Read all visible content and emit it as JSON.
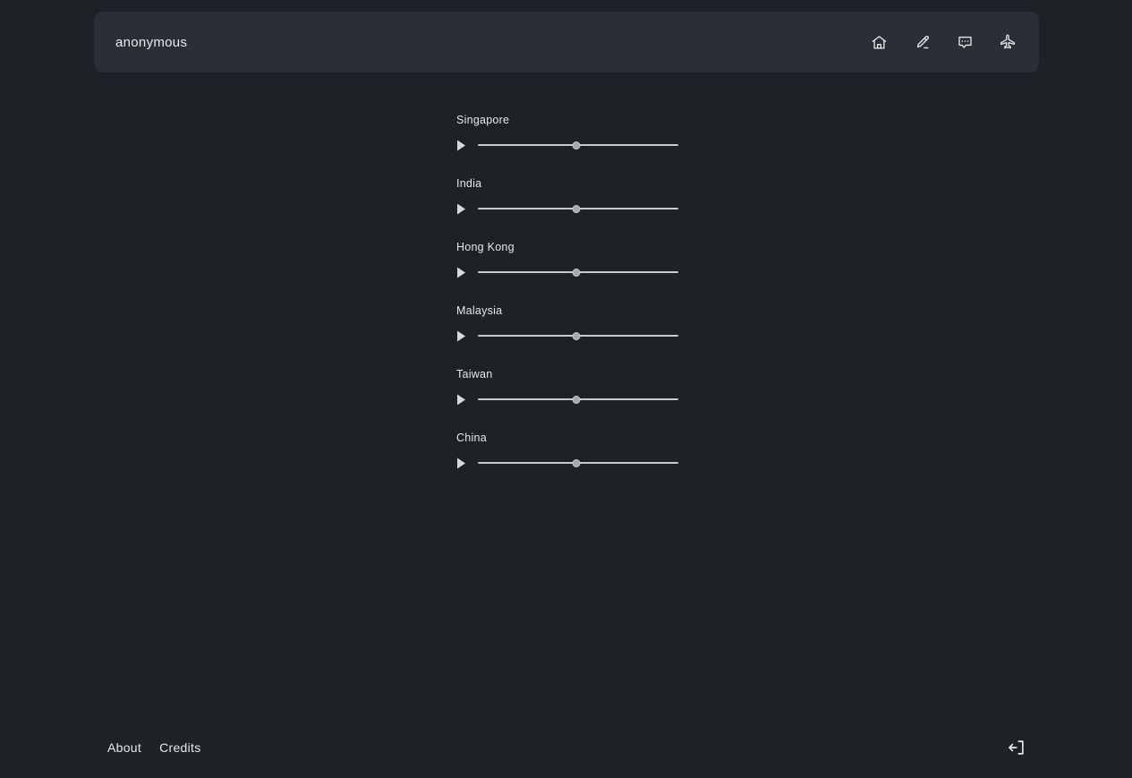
{
  "theme": {
    "page_bg": "#1e2126",
    "panel_bg": "#2b2f35",
    "text": "#e6e8ea",
    "track": "#c9cbcd",
    "thumb": "#a7aaad"
  },
  "header": {
    "title": "anonymous",
    "icons": [
      {
        "name": "home-icon",
        "label": "Home"
      },
      {
        "name": "pencil-icon",
        "label": "Edit"
      },
      {
        "name": "chat-bubble-icon",
        "label": "Comments"
      },
      {
        "name": "airplane-icon",
        "label": "Travel"
      }
    ]
  },
  "main": {
    "sliders": [
      {
        "label": "Singapore",
        "value": 49,
        "min": 0,
        "max": 100,
        "play_label": "Play"
      },
      {
        "label": "India",
        "value": 49,
        "min": 0,
        "max": 100,
        "play_label": "Play"
      },
      {
        "label": "Hong Kong",
        "value": 49,
        "min": 0,
        "max": 100,
        "play_label": "Play"
      },
      {
        "label": "Malaysia",
        "value": 49,
        "min": 0,
        "max": 100,
        "play_label": "Play"
      },
      {
        "label": "Taiwan",
        "value": 49,
        "min": 0,
        "max": 100,
        "play_label": "Play"
      },
      {
        "label": "China",
        "value": 49,
        "min": 0,
        "max": 100,
        "play_label": "Play"
      }
    ]
  },
  "footer": {
    "links": [
      {
        "label": "About"
      },
      {
        "label": "Credits"
      }
    ],
    "logout_icon": "logout-icon"
  }
}
